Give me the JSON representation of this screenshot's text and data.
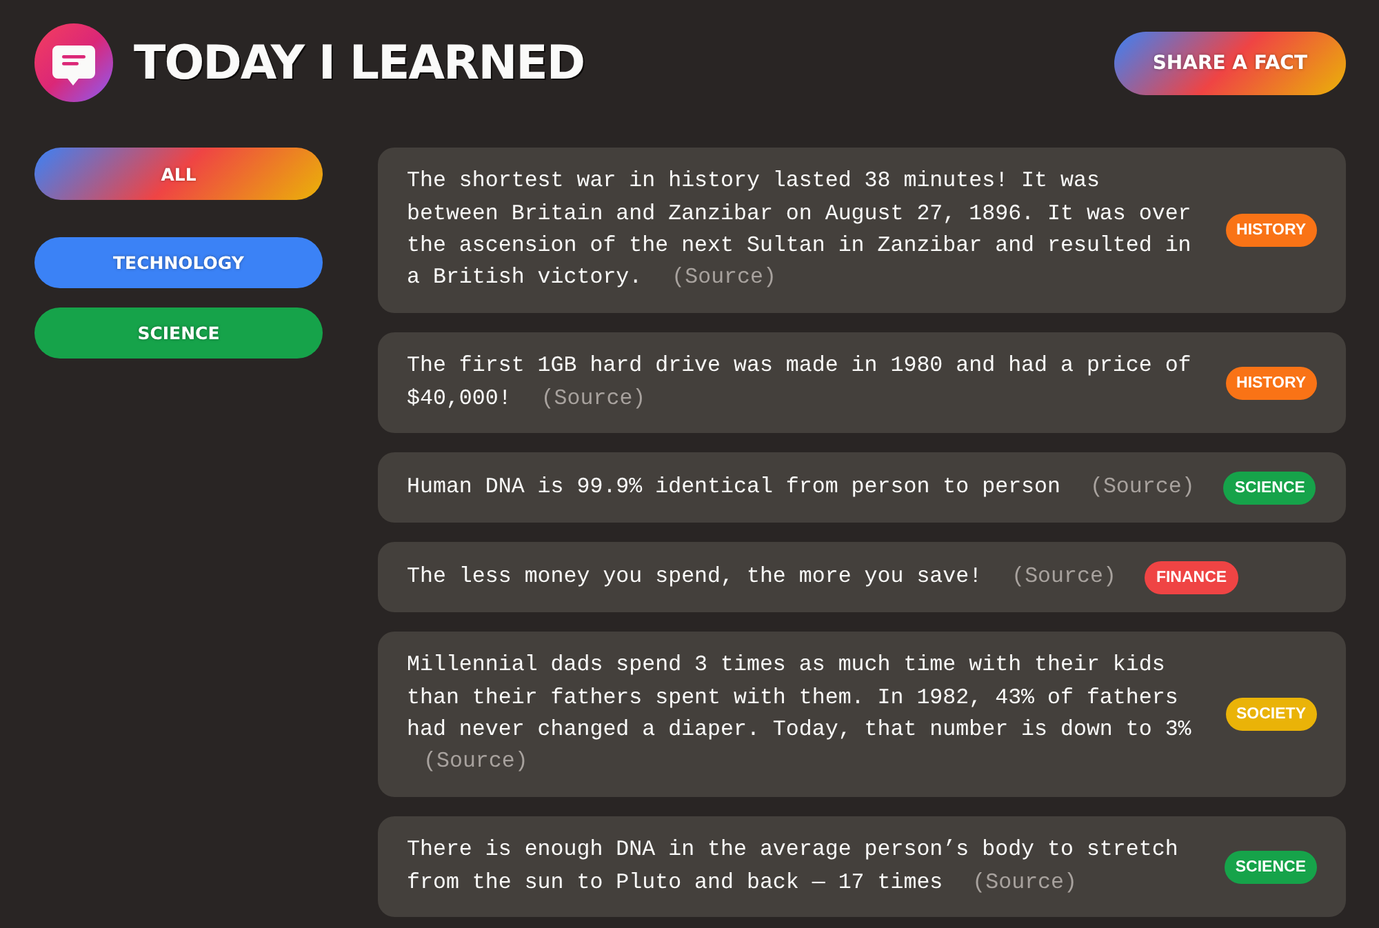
{
  "header": {
    "title": "TODAY I LEARNED",
    "share_button": "SHARE A FACT"
  },
  "sidebar": {
    "all_button": "ALL",
    "categories": [
      {
        "label": "TECHNOLOGY",
        "color": "#3b82f6"
      },
      {
        "label": "SCIENCE",
        "color": "#16a34a"
      }
    ]
  },
  "facts": [
    {
      "text": "The shortest war in history lasted 38 minutes! It was between Britain and Zanzibar on August 27, 1896. It was over the ascension of the next Sultan in Zanzibar and resulted in a British victory.",
      "source": "(Source)",
      "category": "HISTORY",
      "color": "#f97316"
    },
    {
      "text": "The first 1GB hard drive was made in 1980 and had a price of $40,000!",
      "source": "(Source)",
      "category": "HISTORY",
      "color": "#f97316"
    },
    {
      "text": "Human DNA is 99.9% identical from person to person",
      "source": "(Source)",
      "category": "SCIENCE",
      "color": "#16a34a"
    },
    {
      "text": "The less money you spend, the more you save!",
      "source": "(Source)",
      "category": "FINANCE",
      "color": "#ef4444"
    },
    {
      "text": "Millennial dads spend 3 times as much time with their kids than their fathers spent with them. In 1982, 43% of fathers had never changed a diaper. Today, that number is down to 3%",
      "source": "(Source)",
      "category": "SOCIETY",
      "color": "#eab308"
    },
    {
      "text": "There is enough DNA in the average person’s body to stretch from the sun to Pluto and back — 17 times",
      "source": "(Source)",
      "category": "SCIENCE",
      "color": "#16a34a"
    }
  ]
}
